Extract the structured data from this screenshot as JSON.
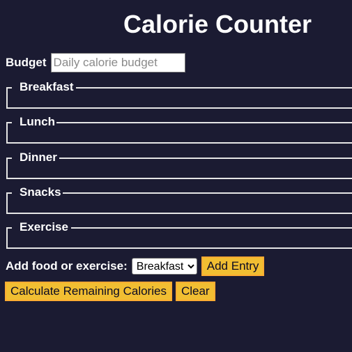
{
  "header": {
    "title": "Calorie Counter"
  },
  "budget": {
    "label": "Budget",
    "placeholder": "Daily calorie budget",
    "value": ""
  },
  "sections": [
    {
      "legend": "Breakfast"
    },
    {
      "legend": "Lunch"
    },
    {
      "legend": "Dinner"
    },
    {
      "legend": "Snacks"
    },
    {
      "legend": "Exercise"
    }
  ],
  "entry": {
    "label": "Add food or exercise:",
    "selected_option": "Breakfast",
    "add_label": "Add Entry"
  },
  "actions": {
    "calculate_label": "Calculate Remaining Calories",
    "clear_label": "Clear"
  },
  "colors": {
    "background": "#1b1b32",
    "button": "#f1be32",
    "text": "#ffffff"
  }
}
